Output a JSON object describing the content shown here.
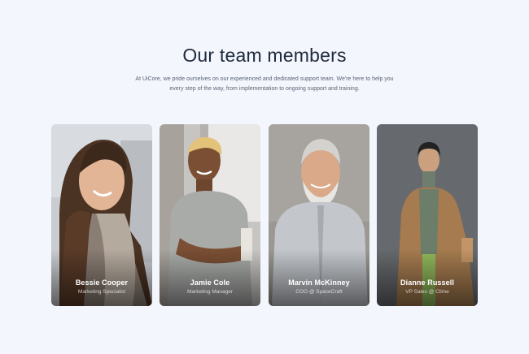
{
  "section": {
    "title": "Our team members",
    "description": "At UiCore, we pride ourselves on our experienced and dedicated support team. We're here to help you every step of the way, from implementation to ongoing support and training."
  },
  "members": [
    {
      "name": "Bessie Cooper",
      "role": "Marketing Specialist"
    },
    {
      "name": "Jamie Cole",
      "role": "Marketing Manager"
    },
    {
      "name": "Marvin McKinney",
      "role": "COO @ SpaceCraft"
    },
    {
      "name": "Dianne Russell",
      "role": "VP Sales @ Clime"
    }
  ]
}
